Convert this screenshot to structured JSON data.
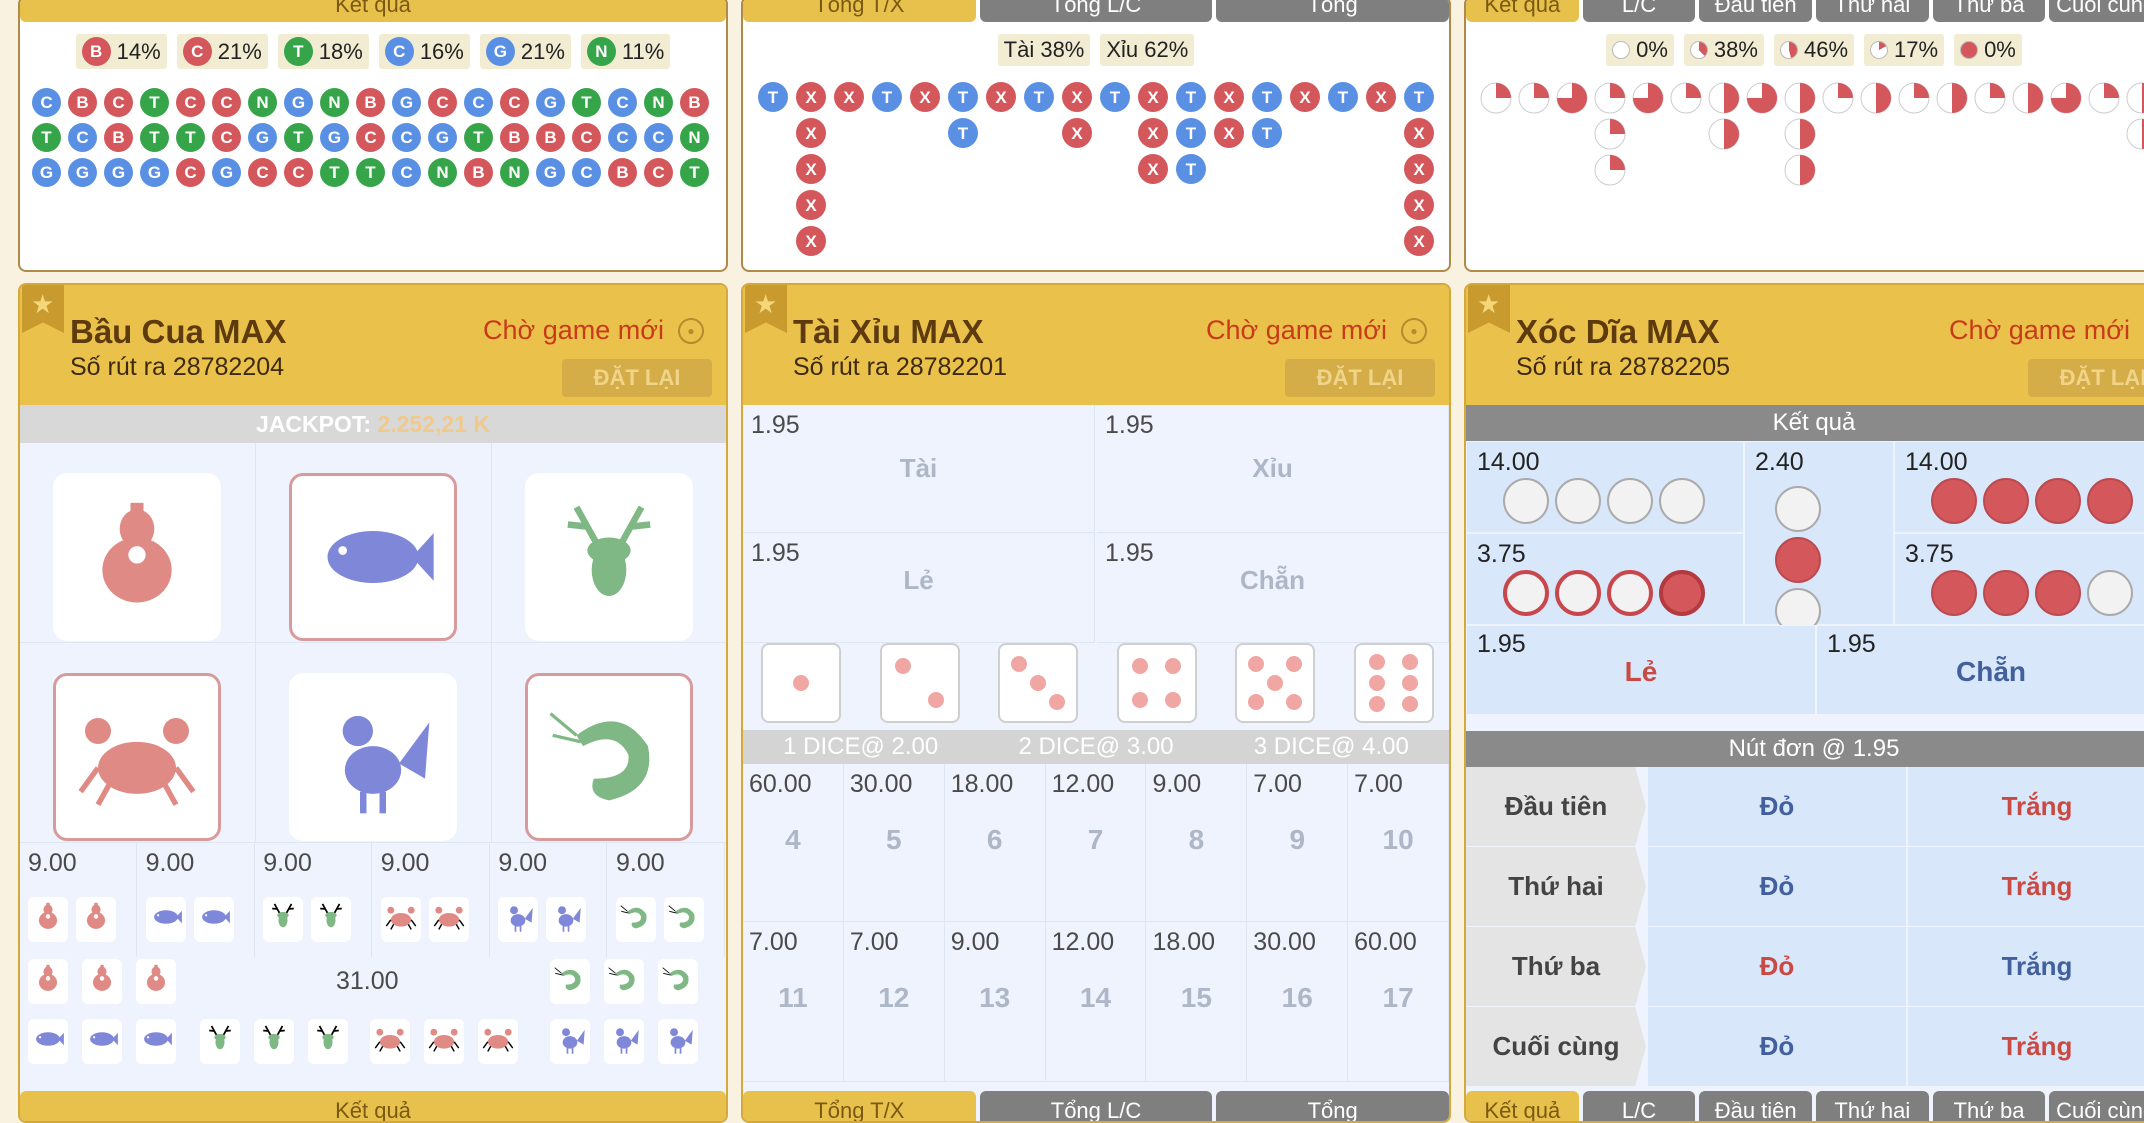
{
  "colors": {
    "red": "#d4575c",
    "blue": "#5990e4",
    "green": "#36a54a",
    "gold": "#eac24b"
  },
  "top_left": {
    "tab": "Kết quả",
    "stats": [
      {
        "l": "B",
        "c": "red",
        "v": "14%"
      },
      {
        "l": "C",
        "c": "red",
        "v": "21%"
      },
      {
        "l": "T",
        "c": "green",
        "v": "18%"
      },
      {
        "l": "C",
        "c": "blue",
        "v": "16%"
      },
      {
        "l": "G",
        "c": "blue",
        "v": "21%"
      },
      {
        "l": "N",
        "c": "green",
        "v": "11%"
      }
    ],
    "rows": [
      [
        "C:b",
        "B:r",
        "C:r",
        "T:g",
        "C:r",
        "C:r",
        "N:g",
        "G:b",
        "N:g",
        "B:r",
        "G:b",
        "C:r",
        "C:b",
        "C:r",
        "G:b",
        "T:g",
        "C:b",
        "N:g",
        "B:r"
      ],
      [
        "T:g",
        "C:b",
        "B:r",
        "T:g",
        "T:g",
        "C:r",
        "G:b",
        "T:g",
        "G:b",
        "C:r",
        "C:b",
        "G:b",
        "T:g",
        "B:r",
        "B:r",
        "C:r",
        "C:b",
        "C:b",
        "N:g"
      ],
      [
        "G:b",
        "G:b",
        "G:b",
        "G:b",
        "C:r",
        "G:b",
        "C:r",
        "C:r",
        "T:g",
        "T:g",
        "C:b",
        "N:g",
        "B:r",
        "N:g",
        "G:b",
        "C:b",
        "B:r",
        "C:r",
        "T:g"
      ]
    ]
  },
  "top_mid": {
    "tabs": [
      "Tổng T/X",
      "Tổng L/C",
      "Tổng"
    ],
    "stats": [
      "Tài 38%",
      "Xỉu 62%"
    ]
  },
  "top_right": {
    "tabs": [
      "Kết quả",
      "L/C",
      "Đầu tiên",
      "Thứ hai",
      "Thứ ba",
      "Cuối cùng"
    ],
    "stats": [
      "0%",
      "38%",
      "46%",
      "17%",
      "0%"
    ]
  },
  "baucua": {
    "title": "Bầu Cua MAX",
    "draw": "Số rút ra 28782204",
    "status": "Chờ game mới",
    "reset": "ĐẶT LẠI",
    "jackpot_label": "JACKPOT:",
    "jackpot_value": "2.252,21 K",
    "pair_odds": [
      "9.00",
      "9.00",
      "9.00",
      "9.00",
      "9.00",
      "9.00"
    ],
    "triple_odds": "31.00",
    "bottom_tab": "Kết quả",
    "animals": [
      {
        "name": "gourd",
        "color": "#e08a86",
        "border": false
      },
      {
        "name": "fish",
        "color": "#7f88d8",
        "border": true
      },
      {
        "name": "deer",
        "color": "#7fb884",
        "border": false
      },
      {
        "name": "crab",
        "color": "#e08a86",
        "border": true
      },
      {
        "name": "rooster",
        "color": "#7f88d8",
        "border": false
      },
      {
        "name": "shrimp",
        "color": "#7fb884",
        "border": true
      }
    ]
  },
  "taixiu": {
    "title": "Tài Xỉu MAX",
    "draw": "Số rút ra 28782201",
    "status": "Chờ game mới",
    "reset": "ĐẶT LẠI",
    "bets": [
      {
        "odd": "1.95",
        "label": "Tài"
      },
      {
        "odd": "1.95",
        "label": "Xỉu"
      },
      {
        "odd": "1.95",
        "label": "Lẻ"
      },
      {
        "odd": "1.95",
        "label": "Chẵn"
      }
    ],
    "dice_header": [
      "1 DICE@ 2.00",
      "2 DICE@ 3.00",
      "3 DICE@ 4.00"
    ],
    "sums_row1": [
      {
        "o": "60.00",
        "n": "4"
      },
      {
        "o": "30.00",
        "n": "5"
      },
      {
        "o": "18.00",
        "n": "6"
      },
      {
        "o": "12.00",
        "n": "7"
      },
      {
        "o": "9.00",
        "n": "8"
      },
      {
        "o": "7.00",
        "n": "9"
      },
      {
        "o": "7.00",
        "n": "10"
      }
    ],
    "sums_row2": [
      {
        "o": "7.00",
        "n": "11"
      },
      {
        "o": "7.00",
        "n": "12"
      },
      {
        "o": "9.00",
        "n": "13"
      },
      {
        "o": "12.00",
        "n": "14"
      },
      {
        "o": "18.00",
        "n": "15"
      },
      {
        "o": "30.00",
        "n": "16"
      },
      {
        "o": "60.00",
        "n": "17"
      }
    ],
    "bottom_tabs": [
      "Tổng T/X",
      "Tổng L/C",
      "Tổng"
    ]
  },
  "xocdia": {
    "title": "Xóc Dĩa MAX",
    "draw": "Số rút ra 28782205",
    "status": "Chờ game mới",
    "reset": "ĐẶT LẠI",
    "result_header": "Kết quả",
    "odds": [
      "14.00",
      "3.75",
      "2.40",
      "14.00",
      "3.75"
    ],
    "le": {
      "odd": "1.95",
      "label": "Lẻ"
    },
    "chan": {
      "odd": "1.95",
      "label": "Chẵn"
    },
    "single_header": "Nút đơn @ 1.95",
    "rows": [
      {
        "name": "Đầu tiên",
        "a": "Đỏ",
        "b": "Trắng"
      },
      {
        "name": "Thứ hai",
        "a": "Đỏ",
        "b": "Trắng"
      },
      {
        "name": "Thứ ba",
        "a": "Đỏ",
        "b": "Trắng"
      },
      {
        "name": "Cuối cùng",
        "a": "Đỏ",
        "b": "Trắng"
      }
    ],
    "bottom_tabs": [
      "Kết quả",
      "L/C",
      "Đầu tiên",
      "Thứ hai",
      "Thứ ba",
      "Cuối cùng"
    ]
  }
}
